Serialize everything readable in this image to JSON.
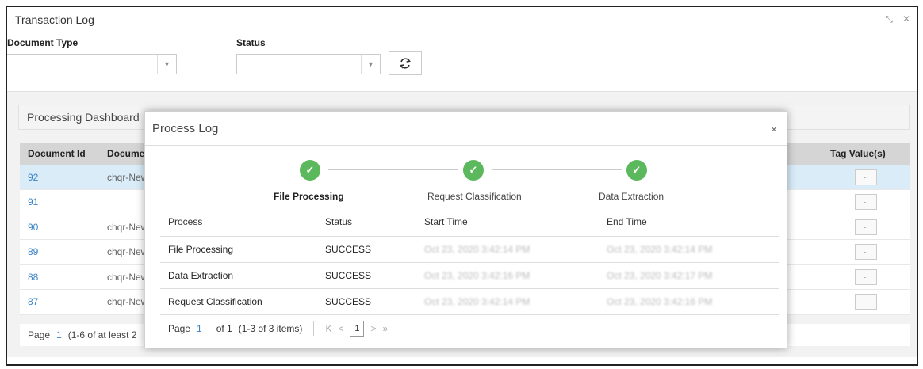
{
  "window": {
    "title": "Transaction Log",
    "controls": {
      "minimize": "⤡",
      "close": "✕"
    }
  },
  "filters": {
    "document_type": {
      "label": "Document Type",
      "value": ""
    },
    "status": {
      "label": "Status",
      "value": ""
    },
    "caret": "▼",
    "refresh_icon": "refresh-icon"
  },
  "dashboard": {
    "title": "Processing Dashboard",
    "columns": [
      "Document Id",
      "Documen",
      "Tag Value(s)"
    ],
    "rows": [
      {
        "id": "92",
        "doc": "chqr-New",
        "tag": "..",
        "selected": true
      },
      {
        "id": "91",
        "doc": "",
        "tag": ".."
      },
      {
        "id": "90",
        "doc": "chqr-New",
        "tag": ".."
      },
      {
        "id": "89",
        "doc": "chqr-New",
        "tag": ".."
      },
      {
        "id": "88",
        "doc": "chqr-New",
        "tag": ".."
      },
      {
        "id": "87",
        "doc": "chqr-New",
        "tag": ".."
      }
    ],
    "pager": {
      "page_label": "Page",
      "page": "1",
      "info": "(1-6 of at least 2"
    }
  },
  "modal": {
    "title": "Process Log",
    "close": "×",
    "steps": [
      {
        "label": "File Processing",
        "status": "done",
        "active": true
      },
      {
        "label": "Request Classification",
        "status": "done"
      },
      {
        "label": "Data Extraction",
        "status": "done"
      }
    ],
    "check_glyph": "✓",
    "table": {
      "columns": [
        "Process",
        "Status",
        "Start Time",
        "End Time"
      ],
      "rows": [
        {
          "process": "File Processing",
          "status": "SUCCESS",
          "start": "Oct 23, 2020 3:42:14 PM",
          "end": "Oct 23, 2020 3:42:14 PM"
        },
        {
          "process": "Data Extraction",
          "status": "SUCCESS",
          "start": "Oct 23, 2020 3:42:16 PM",
          "end": "Oct 23, 2020 3:42:17 PM"
        },
        {
          "process": "Request Classification",
          "status": "SUCCESS",
          "start": "Oct 23, 2020 3:42:14 PM",
          "end": "Oct 23, 2020 3:42:16 PM"
        }
      ]
    },
    "pager": {
      "page_label": "Page",
      "page": "1",
      "of": "of 1",
      "info": "(1-3 of 3 items)",
      "first": "K",
      "prev": "<",
      "current": "1",
      "next": ">",
      "last": "»"
    }
  },
  "colors": {
    "accent": "#3c84c6",
    "success": "#5cb85c",
    "selected_row": "#d9ecf8",
    "header_bg": "#d5d5d5"
  }
}
